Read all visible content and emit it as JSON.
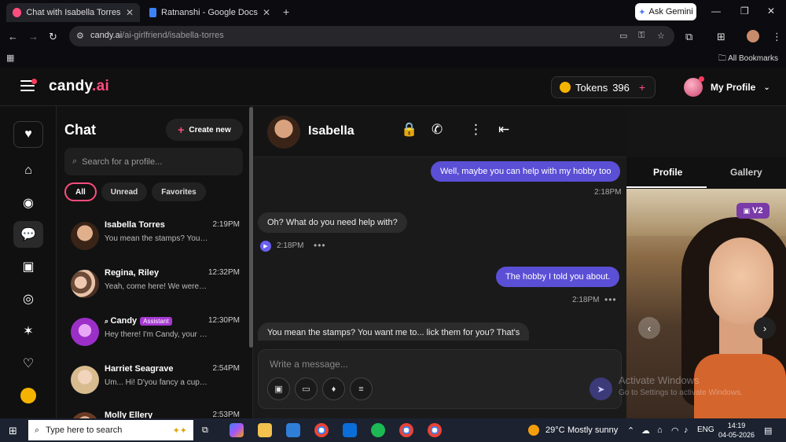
{
  "browser": {
    "tabs": [
      {
        "title": "Chat with Isabella Torres - AI G"
      },
      {
        "title": "Ratnanshi - Google Docs"
      }
    ],
    "new_tab": "+",
    "ask_gemini": "Ask Gemini",
    "url_host": "candy.ai",
    "url_path": "/ai-girlfriend/isabella-torres",
    "bookmarks_label": "All Bookmarks"
  },
  "header": {
    "logo_main": "candy",
    "logo_accent": ".ai",
    "tokens_label": "Tokens",
    "tokens_count": "396",
    "tokens_plus": "+",
    "profile_label": "My Profile"
  },
  "rail": {
    "items": [
      "heart-icon",
      "home-icon",
      "compass-icon",
      "chat-icon",
      "image-icon",
      "camera-icon",
      "wand-icon",
      "heart-broken-icon",
      "coin-icon"
    ]
  },
  "chatlist": {
    "title": "Chat",
    "create_new": "Create new",
    "search_placeholder": "Search for a profile...",
    "filters": [
      "All",
      "Unread",
      "Favorites"
    ],
    "conversations": [
      {
        "name": "Isabella Torres",
        "time": "2:19PM",
        "preview": "You mean the stamps? You want me to... lick them for you?"
      },
      {
        "name": "Regina, Riley",
        "time": "12:32PM",
        "preview": "Yeah, come here! We were waiting"
      },
      {
        "name": "Candy",
        "badge": "Assistant",
        "time": "12:30PM",
        "preview": "Hey there! I'm Candy, your assistant"
      },
      {
        "name": "Harriet Seagrave",
        "time": "2:54PM",
        "preview": "Um... Hi! D'you fancy a cuppa?"
      },
      {
        "name": "Molly Ellery",
        "time": "2:53PM",
        "preview": ""
      }
    ],
    "accent_color": "#ff4d7e"
  },
  "chat": {
    "name": "Isabella",
    "messages": [
      {
        "dir": "out",
        "text": "Well, maybe you can help with my hobby too",
        "time": "2:18PM"
      },
      {
        "dir": "in",
        "text": "Oh? What do you need help with?",
        "time": "2:18PM"
      },
      {
        "dir": "out",
        "text": "The hobby I told you about.",
        "time": "2:18PM"
      },
      {
        "dir": "in",
        "text": "You mean the stamps? You want me to... lick them for you? That's"
      }
    ],
    "composer_placeholder": "Write a message...",
    "outgoing_color": "#5b4fd6"
  },
  "profile_panel": {
    "tabs": [
      "Profile",
      "Gallery"
    ],
    "badge": "V2"
  },
  "watermark": {
    "line1": "Activate Windows",
    "line2": "Go to Settings to activate Windows."
  },
  "taskbar": {
    "search_placeholder": "Type here to search",
    "weather_temp": "29°C",
    "weather_desc": "Mostly sunny",
    "language": "ENG",
    "time": "14:19",
    "date": "04-05-2026"
  }
}
